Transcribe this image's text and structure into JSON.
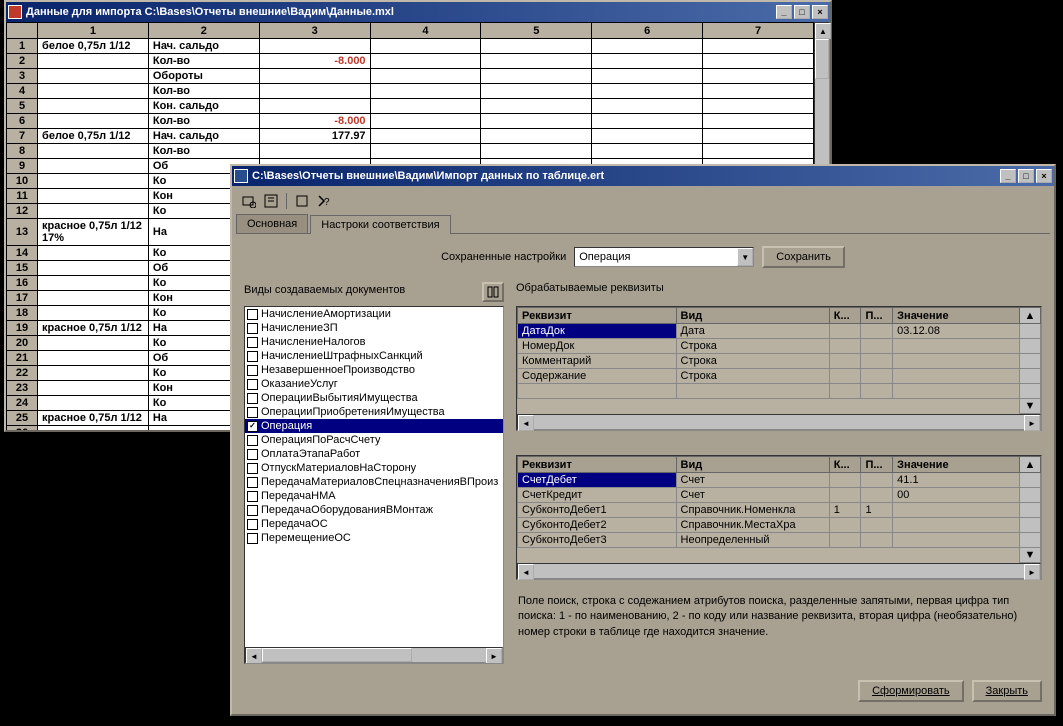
{
  "window1": {
    "title": "Данные для импорта C:\\Bases\\Отчеты внешние\\Вадим\\Данные.mxl",
    "cols": [
      "1",
      "2",
      "3",
      "4",
      "5",
      "6",
      "7"
    ],
    "rows": [
      {
        "n": "1",
        "c1": "белое 0,75л 1/12",
        "c2": "Нач. сальдо",
        "c3": ""
      },
      {
        "n": "2",
        "c1": "",
        "c2": "Кол-во",
        "c3": "-8.000",
        "neg": true
      },
      {
        "n": "3",
        "c1": "",
        "c2": "Обороты",
        "c3": ""
      },
      {
        "n": "4",
        "c1": "",
        "c2": "Кол-во",
        "c3": ""
      },
      {
        "n": "5",
        "c1": "",
        "c2": "Кон. сальдо",
        "c3": ""
      },
      {
        "n": "6",
        "c1": "",
        "c2": "Кол-во",
        "c3": "-8.000",
        "neg": true
      },
      {
        "n": "7",
        "c1": "белое 0,75л 1/12",
        "c2": "Нач. сальдо",
        "c3": "177.97"
      },
      {
        "n": "8",
        "c1": "",
        "c2": "Кол-во",
        "c3": ""
      },
      {
        "n": "9",
        "c1": "",
        "c2": "Об",
        "c3": ""
      },
      {
        "n": "10",
        "c1": "",
        "c2": "Ко",
        "c3": ""
      },
      {
        "n": "11",
        "c1": "",
        "c2": "Кон",
        "c3": ""
      },
      {
        "n": "12",
        "c1": "",
        "c2": "Ко",
        "c3": ""
      },
      {
        "n": "13",
        "c1": "красное 0,75л 1/12  17%",
        "c2": "На",
        "c3": ""
      },
      {
        "n": "14",
        "c1": "",
        "c2": "Ко",
        "c3": ""
      },
      {
        "n": "15",
        "c1": "",
        "c2": "Об",
        "c3": ""
      },
      {
        "n": "16",
        "c1": "",
        "c2": "Ко",
        "c3": ""
      },
      {
        "n": "17",
        "c1": "",
        "c2": "Кон",
        "c3": ""
      },
      {
        "n": "18",
        "c1": "",
        "c2": "Ко",
        "c3": ""
      },
      {
        "n": "19",
        "c1": "красное 0,75л 1/12",
        "c2": "На",
        "c3": ""
      },
      {
        "n": "20",
        "c1": "",
        "c2": "Ко",
        "c3": ""
      },
      {
        "n": "21",
        "c1": "",
        "c2": "Об",
        "c3": ""
      },
      {
        "n": "22",
        "c1": "",
        "c2": "Ко",
        "c3": ""
      },
      {
        "n": "23",
        "c1": "",
        "c2": "Кон",
        "c3": ""
      },
      {
        "n": "24",
        "c1": "",
        "c2": "Ко",
        "c3": ""
      },
      {
        "n": "25",
        "c1": "красное 0,75л 1/12",
        "c2": "На",
        "c3": ""
      },
      {
        "n": "26",
        "c1": "",
        "c2": "",
        "c3": ""
      }
    ]
  },
  "window2": {
    "title": "C:\\Bases\\Отчеты внешние\\Вадим\\Импорт данных по таблице.ert",
    "tabs": {
      "main": "Основная",
      "settings": "Настроки соответствия"
    },
    "saved_settings_label": "Сохраненные настройки",
    "combo_value": "Операция",
    "save_label": "Сохранить",
    "doc_types_label": "Виды создаваемых документов",
    "doc_types": [
      {
        "label": "НачислениеАмортизации",
        "checked": false
      },
      {
        "label": "НачислениеЗП",
        "checked": false
      },
      {
        "label": "НачислениеНалогов",
        "checked": false
      },
      {
        "label": "НачислениеШтрафныхСанкций",
        "checked": false
      },
      {
        "label": "НезавершенноеПроизводство",
        "checked": false
      },
      {
        "label": "ОказаниеУслуг",
        "checked": false
      },
      {
        "label": "ОперацииВыбытияИмущества",
        "checked": false
      },
      {
        "label": "ОперацииПриобретенияИмущества",
        "checked": false
      },
      {
        "label": "Операция",
        "checked": true,
        "selected": true
      },
      {
        "label": "ОперацияПоРасчСчету",
        "checked": false
      },
      {
        "label": "ОплатаЭтапаРабот",
        "checked": false
      },
      {
        "label": "ОтпускМатериаловНаСторону",
        "checked": false
      },
      {
        "label": "ПередачаМатериаловСпецназначенияВПроиз",
        "checked": false
      },
      {
        "label": "ПередачаНМА",
        "checked": false
      },
      {
        "label": "ПередачаОборудованияВМонтаж",
        "checked": false
      },
      {
        "label": "ПередачаОС",
        "checked": false
      },
      {
        "label": "ПеремещениеОС",
        "checked": false
      }
    ],
    "req_label": "Обрабатываемые реквизиты",
    "grid1": {
      "headers": [
        "Реквизит",
        "Вид",
        "К...",
        "П...",
        "Значение"
      ],
      "rows": [
        {
          "r": "ДатаДок",
          "v": "Дата",
          "k": "",
          "p": "",
          "z": "03.12.08",
          "sel": true
        },
        {
          "r": "НомерДок",
          "v": "Строка",
          "k": "",
          "p": "",
          "z": ""
        },
        {
          "r": "Комментарий",
          "v": "Строка",
          "k": "",
          "p": "",
          "z": ""
        },
        {
          "r": "Содержание",
          "v": "Строка",
          "k": "",
          "p": "",
          "z": ""
        }
      ]
    },
    "grid2": {
      "headers": [
        "Реквизит",
        "Вид",
        "К...",
        "П...",
        "Значение"
      ],
      "rows": [
        {
          "r": "СчетДебет",
          "v": "Счет",
          "k": "",
          "p": "",
          "z": "41.1",
          "sel": true
        },
        {
          "r": "СчетКредит",
          "v": "Счет",
          "k": "",
          "p": "",
          "z": "00"
        },
        {
          "r": "СубконтоДебет1",
          "v": "Справочник.Номенкла",
          "k": "1",
          "p": "1",
          "z": ""
        },
        {
          "r": "СубконтоДебет2",
          "v": "Справочник.МестаХра",
          "k": "",
          "p": "",
          "z": ""
        },
        {
          "r": "СубконтоДебет3",
          "v": "Неопределенный",
          "k": "",
          "p": "",
          "z": ""
        }
      ]
    },
    "help_text": "Поле поиск, строка с содежанием атрибутов поиска, разделенные запятыми, первая цифра тип поиска: 1 - по наименованию, 2 - по коду или название реквизита, вторая цифра (необязательно) номер строки в таблице где находится значение.",
    "form_btn": "Сформировать",
    "close_btn": "Закрыть"
  }
}
